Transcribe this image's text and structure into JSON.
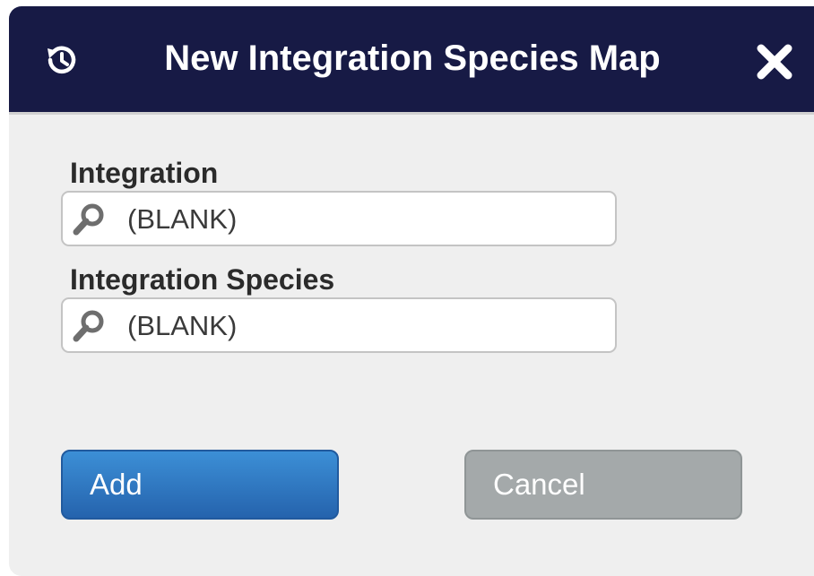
{
  "dialog": {
    "title": "New Integration Species Map",
    "history_icon": "history-icon",
    "close_icon": "close-icon"
  },
  "fields": [
    {
      "label": "Integration",
      "value": "(BLANK)",
      "icon": "search-icon"
    },
    {
      "label": "Integration Species",
      "value": "(BLANK)",
      "icon": "search-icon"
    }
  ],
  "buttons": {
    "add_label": "Add",
    "cancel_label": "Cancel"
  },
  "colors": {
    "titlebar": "#171a45",
    "background": "#efefef",
    "add_button": "#2f78c4",
    "cancel_button": "#a4a9aa"
  }
}
